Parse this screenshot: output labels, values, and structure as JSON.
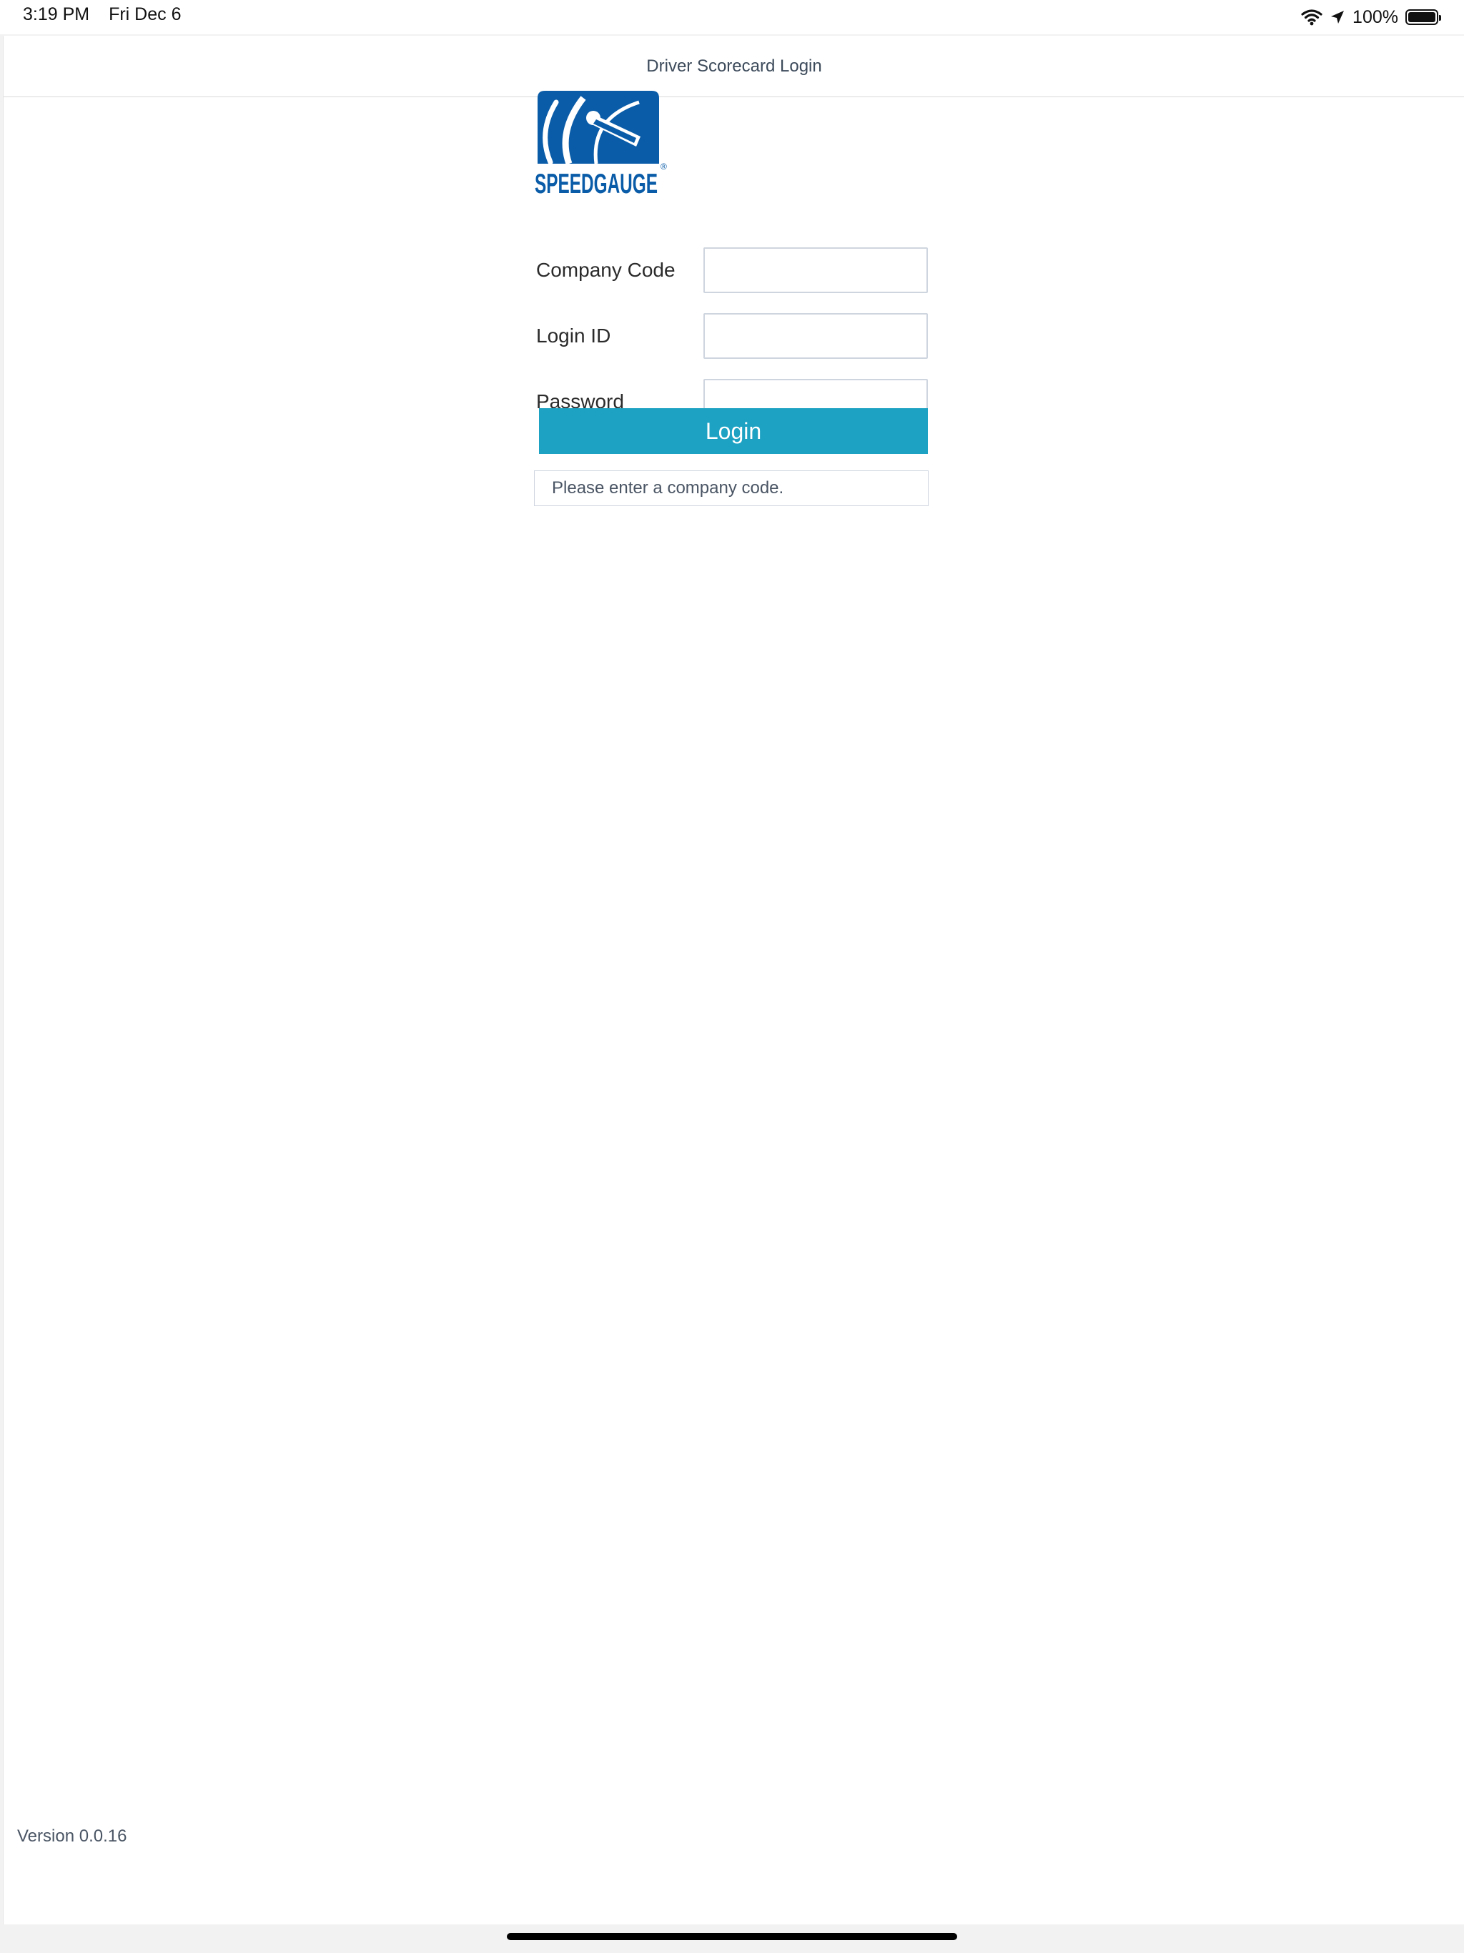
{
  "status_bar": {
    "time": "3:19 PM",
    "date": "Fri Dec 6",
    "battery": "100%",
    "battery_level": 1.0,
    "icons": [
      "wifi-icon",
      "location-icon",
      "battery-icon"
    ]
  },
  "header": {
    "title": "Driver Scorecard Login"
  },
  "logo": {
    "text": "SPEEDGAUGE",
    "registered_mark": "®",
    "brand_color": "#0a5ca8"
  },
  "form": {
    "company_code": {
      "label": "Company Code",
      "value": ""
    },
    "login_id": {
      "label": "Login ID",
      "value": ""
    },
    "password": {
      "label": "Password",
      "value": ""
    },
    "login_button": "Login",
    "accent_color": "#1ea2c3"
  },
  "message": "Please enter a company code.",
  "footer": {
    "version": "Version 0.0.16"
  }
}
